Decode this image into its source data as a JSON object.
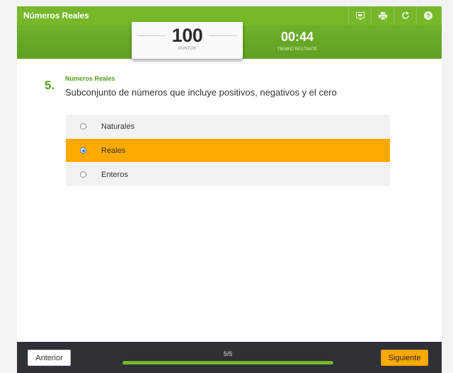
{
  "header": {
    "title": "Números Reales",
    "icons": [
      "slideshow-icon",
      "print-icon",
      "refresh-icon",
      "help-icon"
    ]
  },
  "score": {
    "value": "100",
    "label": "PUNTOS"
  },
  "timer": {
    "value": "00:44",
    "label": "TIEMPO RESTANTE"
  },
  "question": {
    "number": "5.",
    "category": "Números Reales",
    "text": "Subconjunto de números que incluye positivos, negativos y el cero"
  },
  "answers": [
    {
      "label": "Naturales",
      "selected": false
    },
    {
      "label": "Reales",
      "selected": true
    },
    {
      "label": "Enteros",
      "selected": false
    }
  ],
  "footer": {
    "prev_label": "Anterior",
    "next_label": "Siguiente",
    "progress_text": "5/5",
    "progress_fraction": 1.0
  },
  "colors": {
    "accent_green": "#76b82a",
    "selected_orange": "#ffaa00",
    "footer_dark": "#2e3136"
  }
}
